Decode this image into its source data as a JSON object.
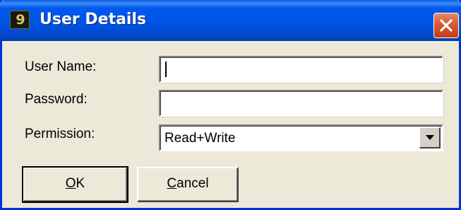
{
  "window": {
    "title": "User Details",
    "icon": "app-icon",
    "close_icon": "close-icon"
  },
  "form": {
    "username": {
      "label": "User Name:",
      "value": ""
    },
    "password": {
      "label": "Password:",
      "value": ""
    },
    "permission": {
      "label": "Permission:",
      "selected": "Read+Write",
      "arrow_icon": "chevron-down-icon"
    }
  },
  "buttons": {
    "ok": {
      "mnemonic": "O",
      "rest": "K"
    },
    "cancel": {
      "mnemonic": "C",
      "rest": "ancel"
    }
  },
  "colors": {
    "titlebar": "#0054e3",
    "close": "#d65a34",
    "dialog_bg": "#ece9d8"
  }
}
